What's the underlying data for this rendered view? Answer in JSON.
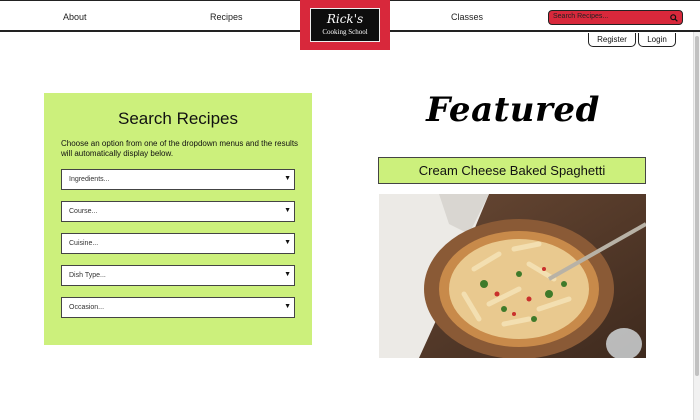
{
  "nav": {
    "about": "About",
    "recipes": "Recipes",
    "classes": "Classes"
  },
  "logo": {
    "line1": "Rick's",
    "line2": "Cooking School"
  },
  "search": {
    "placeholder": "Search Recipes..."
  },
  "account": {
    "register": "Register",
    "login": "Login"
  },
  "search_panel": {
    "title": "Search Recipes",
    "description": "Choose an option from one of the dropdown menus and the results will automatically display below.",
    "dropdowns": [
      "Ingredients...",
      "Course...",
      "Cuisine...",
      "Dish Type...",
      "Occasion..."
    ]
  },
  "featured": {
    "heading": "Featured",
    "recipe_title": "Cream Cheese Baked Spaghetti"
  },
  "colors": {
    "accent_red": "#d8283b",
    "lime": "#ccf07c"
  }
}
